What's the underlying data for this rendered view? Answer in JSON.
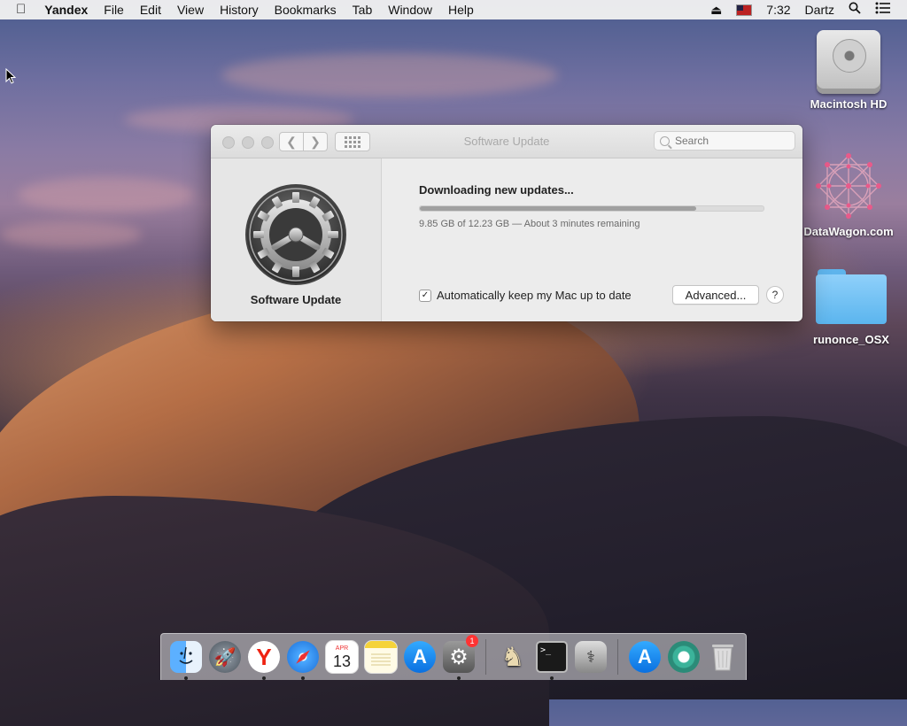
{
  "menubar": {
    "app_name": "Yandex",
    "menus": [
      "File",
      "Edit",
      "View",
      "History",
      "Bookmarks",
      "Tab",
      "Window",
      "Help"
    ],
    "time": "7:32",
    "user": "Dartz"
  },
  "desktop": {
    "icons": [
      {
        "label": "Macintosh HD",
        "icon": "hard-drive-icon"
      },
      {
        "label": "DataWagon.com",
        "icon": "molecule-icon"
      },
      {
        "label": "runonce_OSX",
        "icon": "folder-icon"
      }
    ]
  },
  "window": {
    "title": "Software Update",
    "search_placeholder": "Search",
    "sidebar_label": "Software Update",
    "status": "Downloading new updates...",
    "progress_fraction": 0.805,
    "detail": "9.85 GB of 12.23 GB — About 3 minutes remaining",
    "auto_update_label": "Automatically keep my Mac up to date",
    "auto_update_checked": true,
    "advanced_label": "Advanced...",
    "help_label": "?"
  },
  "dock": {
    "items": [
      "Finder",
      "Launchpad",
      "Yandex",
      "Safari",
      "Calendar",
      "Notes",
      "App Store",
      "System Preferences",
      "Chess",
      "Terminal",
      "Disk Utility",
      "App Store",
      "Sourcetree",
      "Trash"
    ],
    "calendar_month": "APR",
    "calendar_day": "13",
    "badge_count": "1",
    "colors": {
      "finder": "#3d8fe0",
      "launchpad": "#6b7580",
      "yandex": "#ffffff",
      "safari": "#2a7de0",
      "appstore": "#1e8df0",
      "terminal": "#1a1a1a"
    }
  }
}
